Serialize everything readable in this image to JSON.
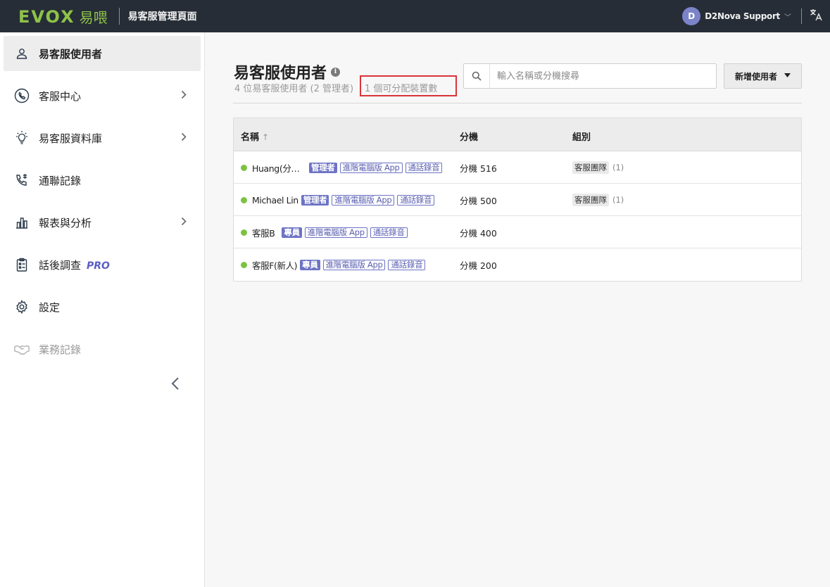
{
  "header": {
    "logo_text": "EVOX",
    "logo_cn": "易喂",
    "title": "易客服管理頁面",
    "user_initial": "D",
    "user_name": "D2Nova Support",
    "chevron": "﹀",
    "lang_icon": "translate-icon"
  },
  "sidebar": {
    "items": [
      {
        "label": "易客服使用者",
        "icon": "user-icon",
        "active": true
      },
      {
        "label": "客服中心",
        "icon": "call-center-icon",
        "chevron": true
      },
      {
        "label": "易客服資料庫",
        "icon": "lightbulb-icon",
        "chevron": true
      },
      {
        "label": "通聯記錄",
        "icon": "phone-log-icon"
      },
      {
        "label": "報表與分析",
        "icon": "chart-icon",
        "chevron": true
      },
      {
        "label": "話後調查",
        "icon": "clipboard-icon",
        "badge": "PRO"
      },
      {
        "label": "設定",
        "icon": "gear-icon"
      },
      {
        "label": "業務記錄",
        "icon": "handshake-icon",
        "disabled": true
      }
    ]
  },
  "main": {
    "title": "易客服使用者",
    "info_glyph": "i",
    "subtitle": "4 位易客服使用者 (2 管理者)",
    "device_count": "1 個可分配裝置數",
    "search": {
      "placeholder": "輸入名稱或分機搜尋",
      "value": ""
    },
    "add_button": "新增使用者",
    "table": {
      "columns": [
        "名稱",
        "分機",
        "組別"
      ],
      "sort_glyph": "↑",
      "rows": [
        {
          "name": "Huang(分…",
          "tags": [
            {
              "text": "管理者",
              "style": "solid"
            },
            {
              "text": "進階電腦版 App",
              "style": "outline"
            },
            {
              "text": "通話錄音",
              "style": "outline"
            }
          ],
          "extension": "分機 516",
          "group": "客服團隊",
          "group_count": "(1)"
        },
        {
          "name": "Michael Lin",
          "tags": [
            {
              "text": "管理者",
              "style": "solid"
            },
            {
              "text": "進階電腦版 App",
              "style": "outline"
            },
            {
              "text": "通話錄音",
              "style": "outline"
            }
          ],
          "extension": "分機 500",
          "group": "客服團隊",
          "group_count": "(1)"
        },
        {
          "name": "客服B",
          "tags": [
            {
              "text": "專員",
              "style": "solid"
            },
            {
              "text": "進階電腦版 App",
              "style": "outline"
            },
            {
              "text": "通話錄音",
              "style": "outline"
            }
          ],
          "extension": "分機 400",
          "group": "",
          "group_count": ""
        },
        {
          "name": "客服F(新人)",
          "tags": [
            {
              "text": "專員",
              "style": "solid"
            },
            {
              "text": "進階電腦版 App",
              "style": "outline"
            },
            {
              "text": "通話錄音",
              "style": "outline"
            }
          ],
          "extension": "分機 200",
          "group": "",
          "group_count": ""
        }
      ]
    }
  },
  "colors": {
    "topbar": "#262d36",
    "brand_green": "#8ec24a",
    "tag_purple": "#6d73c4",
    "status_green": "#7cc242",
    "highlight_red": "#d9343a"
  }
}
